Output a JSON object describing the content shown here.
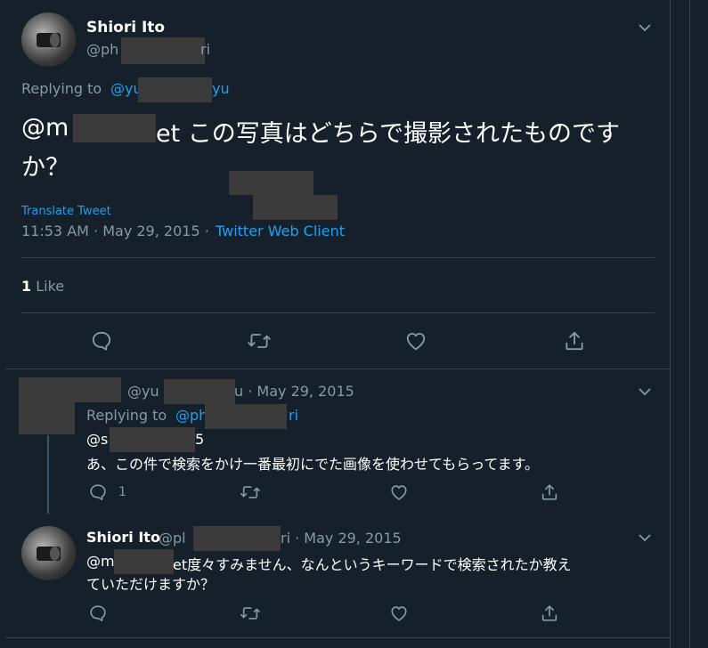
{
  "main_tweet": {
    "author_name": "Shiori Ito",
    "handle_prefix": "@ph",
    "handle_suffix": "ri",
    "replying_label": "Replying to ",
    "replying_prefix": "@yu",
    "replying_suffix": "yu",
    "text_line1_prefix": "@m",
    "text_line1_suffix": "et この写真はどちらで撮影されたものです",
    "text_line2": "か？",
    "translate": "Translate Tweet",
    "timestamp": "11:53 AM · May 29, 2015 · ",
    "client": "Twitter Web Client",
    "likes_count": "1",
    "likes_label": " Like"
  },
  "reply1": {
    "handle_prefix": "@yu",
    "handle_suffix": "u · May 29, 2015",
    "replying_label": "Replying to ",
    "replying_prefix": "@ph",
    "replying_suffix": "ri",
    "text_line1_prefix": "@s",
    "text_line1_suffix": "5",
    "text_line2": "あ、この件で検索をかけ一番最初にでた画像を使わせてもらってます。",
    "reply_count": "1"
  },
  "reply2": {
    "author_name": "Shiori Ito",
    "handle_prefix": "@pl",
    "handle_suffix": "ri · May 29, 2015",
    "text_line1_prefix": "@m",
    "text_line1_suffix": "et度々すみません、なんというキーワードで検索されたか教え",
    "text_line2": "ていただけますか？"
  },
  "icons": [
    "reply-icon",
    "retweet-icon",
    "like-icon",
    "share-icon",
    "chevron-down-icon"
  ],
  "colors": {
    "background": "#15202b",
    "accent": "#1da1f2",
    "muted": "#8899a6",
    "border": "#38444d"
  }
}
